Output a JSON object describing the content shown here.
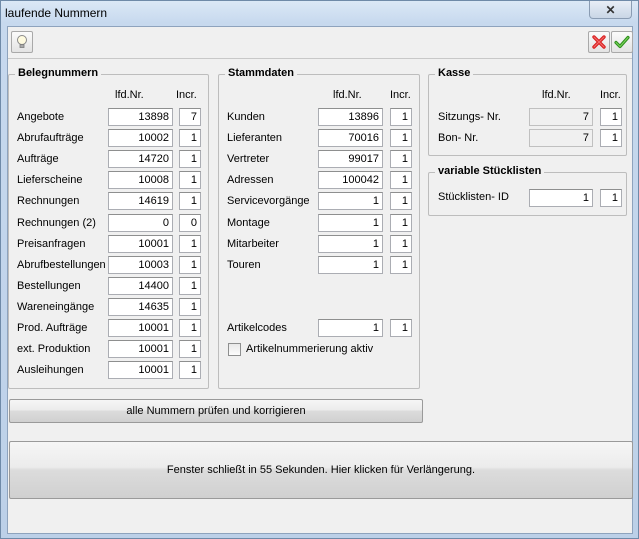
{
  "window": {
    "title": "laufende Nummern",
    "close_label": "✕"
  },
  "toolbar": {
    "help": "lightbulb-icon",
    "cancel": "red-x-icon",
    "ok": "green-check-icon"
  },
  "belegnummern": {
    "title": "Belegnummern",
    "col_nr": "lfd.Nr.",
    "col_incr": "Incr.",
    "rows": [
      {
        "label": "Angebote",
        "nr": "13898",
        "incr": "7"
      },
      {
        "label": "Abrufaufträge",
        "nr": "10002",
        "incr": "1"
      },
      {
        "label": "Aufträge",
        "nr": "14720",
        "incr": "1"
      },
      {
        "label": "Lieferscheine",
        "nr": "10008",
        "incr": "1"
      },
      {
        "label": "Rechnungen",
        "nr": "14619",
        "incr": "1"
      },
      {
        "label": "Rechnungen (2)",
        "nr": "0",
        "incr": "0"
      },
      {
        "label": "Preisanfragen",
        "nr": "10001",
        "incr": "1"
      },
      {
        "label": "Abrufbestellungen",
        "nr": "10003",
        "incr": "1"
      },
      {
        "label": "Bestellungen",
        "nr": "14400",
        "incr": "1"
      },
      {
        "label": "Wareneingänge",
        "nr": "14635",
        "incr": "1"
      },
      {
        "label": "Prod. Aufträge",
        "nr": "10001",
        "incr": "1"
      },
      {
        "label": "ext. Produktion",
        "nr": "10001",
        "incr": "1"
      },
      {
        "label": "Ausleihungen",
        "nr": "10001",
        "incr": "1"
      }
    ]
  },
  "stammdaten": {
    "title": "Stammdaten",
    "col_nr": "lfd.Nr.",
    "col_incr": "Incr.",
    "rows": [
      {
        "label": "Kunden",
        "nr": "13896",
        "incr": "1"
      },
      {
        "label": "Lieferanten",
        "nr": "70016",
        "incr": "1"
      },
      {
        "label": "Vertreter",
        "nr": "99017",
        "incr": "1"
      },
      {
        "label": "Adressen",
        "nr": "100042",
        "incr": "1"
      },
      {
        "label": "Servicevorgänge",
        "nr": "1",
        "incr": "1"
      },
      {
        "label": "Montage",
        "nr": "1",
        "incr": "1"
      },
      {
        "label": "Mitarbeiter",
        "nr": "1",
        "incr": "1"
      },
      {
        "label": "Touren",
        "nr": "1",
        "incr": "1"
      }
    ],
    "artikelcodes": {
      "label": "Artikelcodes",
      "nr": "1",
      "incr": "1"
    },
    "checkbox_label": "Artikelnummerierung aktiv"
  },
  "kasse": {
    "title": "Kasse",
    "col_nr": "lfd.Nr.",
    "col_incr": "Incr.",
    "rows": [
      {
        "label": "Sitzungs- Nr.",
        "nr": "7",
        "incr": "1"
      },
      {
        "label": "Bon- Nr.",
        "nr": "7",
        "incr": "1"
      }
    ]
  },
  "stuecklisten": {
    "title": "variable Stücklisten",
    "label": "Stücklisten- ID",
    "nr": "1",
    "incr": "1"
  },
  "buttons": {
    "check_all": "alle Nummern prüfen und korrigieren",
    "timer": "Fenster schließt in 55 Sekunden. Hier klicken für Verlängerung."
  }
}
